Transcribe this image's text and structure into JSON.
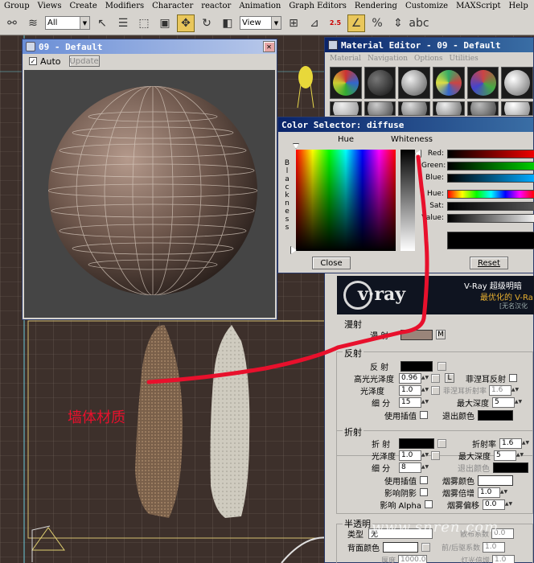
{
  "menu": [
    "Group",
    "Views",
    "Create",
    "Modifiers",
    "Character",
    "reactor",
    "Animation",
    "Graph Editors",
    "Rendering",
    "Customize",
    "MAXScript",
    "Help"
  ],
  "toolbar": {
    "selection_filter": "All",
    "reference_coord": "View",
    "snap_label": "2.5"
  },
  "render_window": {
    "title": "09 - Default",
    "auto_label": "Auto",
    "auto_checked": true,
    "update_label": "Update"
  },
  "material_editor": {
    "title": "Material Editor - 09 - Default",
    "menu": [
      "Material",
      "Navigation",
      "Options",
      "Utilities"
    ],
    "vray_banner_line1": "V-Ray 超级明暗",
    "vray_banner_line2": "最优化的 V-Ra",
    "vray_banner_line3": "[无名汉化",
    "vray_logo": "v·ray",
    "diffuse_group": "漫射",
    "diffuse_label": "漫  射",
    "diffuse_map_button": "M",
    "reflection_group": "反射",
    "reflect_label": "反  射",
    "hilight_gloss_label": "高光光泽度",
    "hilight_gloss_value": "0.96",
    "lock_button": "L",
    "fresnel_label": "菲涅耳反射",
    "gloss_label": "光泽度",
    "gloss_value": "1.0",
    "fresnel_ior_label": "菲涅耳折射率",
    "fresnel_ior_value": "1.6",
    "subdivs_label": "细  分",
    "subdivs_value": "15",
    "max_depth_label": "最大深度",
    "max_depth_value": "5",
    "use_interp_label": "使用插值",
    "exit_color_label": "退出颜色",
    "refraction_group": "折射",
    "refract_label": "折  射",
    "ior_label": "折射率",
    "ior_value": "1.6",
    "refr_gloss_label": "光泽度",
    "refr_gloss_value": "1.0",
    "refr_max_depth_label": "最大深度",
    "refr_max_depth_value": "5",
    "refr_subdivs_label": "细  分",
    "refr_subdivs_value": "8",
    "refr_exit_color_label": "退出颜色",
    "refr_use_interp_label": "使用插值",
    "fog_color_label": "烟雾颜色",
    "affect_shadows_label": "影响阴影",
    "fog_mult_label": "烟雾倍增",
    "fog_mult_value": "1.0",
    "affect_alpha_label": "影响 Alpha",
    "fog_bias_label": "烟雾偏移",
    "fog_bias_value": "0.0",
    "translucency_group": "半透明",
    "type_label": "类型",
    "type_value": "无",
    "back_color_label": "背面颜色",
    "scatter_label": "散布系数",
    "scatter_value": "0.0",
    "fwd_back_label": "前/后驱系数",
    "fwd_back_value": "1.0",
    "light_mult_label": "灯光倍增",
    "light_mult_value": "1.0",
    "thickness_label": "厚度",
    "thickness_value": "1000.0"
  },
  "color_selector": {
    "title": "Color Selector: diffuse",
    "hue_label": "Hue",
    "whiteness_label": "Whiteness",
    "blackness_letters": [
      "B",
      "l",
      "a",
      "c",
      "k",
      "n",
      "e",
      "s",
      "s"
    ],
    "red_label": "Red:",
    "green_label": "Green:",
    "blue_label": "Blue:",
    "hue_slider_label": "Hue:",
    "sat_label": "Sat:",
    "value_label": "Value:",
    "close_button": "Close",
    "reset_button": "Reset"
  },
  "annotation": {
    "wall_label": "墙体材质",
    "color": "#e8102c"
  },
  "watermark": "www.snren.com",
  "colors": {
    "ui_gray": "#d6d3ce",
    "title_blue": "#0a246a",
    "annotation_red": "#e8102c"
  }
}
